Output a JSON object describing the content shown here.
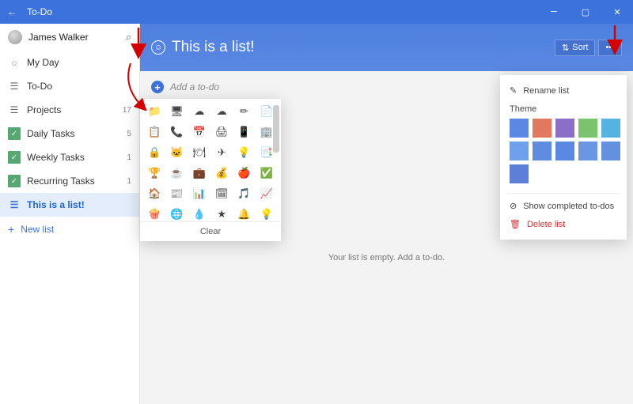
{
  "titlebar": {
    "app": "To-Do"
  },
  "user": {
    "name": "James Walker"
  },
  "sidebar": {
    "items": [
      {
        "label": "My Day",
        "icon": "sun",
        "count": null
      },
      {
        "label": "To-Do",
        "icon": "list-grey",
        "count": null
      },
      {
        "label": "Projects",
        "icon": "list-grey",
        "count": "17"
      },
      {
        "label": "Daily Tasks",
        "icon": "check-green",
        "count": "5"
      },
      {
        "label": "Weekly Tasks",
        "icon": "check-green",
        "count": "1"
      },
      {
        "label": "Recurring Tasks",
        "icon": "check-green",
        "count": "1"
      },
      {
        "label": "This is a list!",
        "icon": "list-blue",
        "count": null,
        "selected": true
      }
    ],
    "newlist": "New list"
  },
  "list": {
    "title": "This is a list!",
    "add_placeholder": "Add a to-do",
    "empty_text": "Your list is empty. Add a to-do.",
    "sort_label": "Sort"
  },
  "emoji_picker": {
    "clear_label": "Clear",
    "glyphs": [
      "📁",
      "🖥",
      "☁",
      "☁",
      "✏",
      "📄",
      "📋",
      "📞",
      "📅",
      "🖨",
      "📱",
      "🏢",
      "🔒",
      "🐱",
      "🍽",
      "✈",
      "💡",
      "📑",
      "🏆",
      "☕",
      "💼",
      "💰",
      "🍎",
      "✅",
      "🏠",
      "📰",
      "📊",
      "🗓",
      "🎵",
      "📈",
      "🍿",
      "🌐",
      "💧",
      "★",
      "🔔",
      "💡"
    ]
  },
  "ctxmenu": {
    "rename": "Rename list",
    "theme_label": "Theme",
    "swatches": [
      "#5a88e2",
      "#e2795f",
      "#8b6ec8",
      "#7cc36e",
      "#54b3e0",
      "#6fa0ec",
      "#5f8ce0",
      "#5a88e2",
      "#6b96e3",
      "#6390df",
      "#5d7fd8"
    ],
    "show_completed": "Show completed to-dos",
    "delete": "Delete list"
  }
}
